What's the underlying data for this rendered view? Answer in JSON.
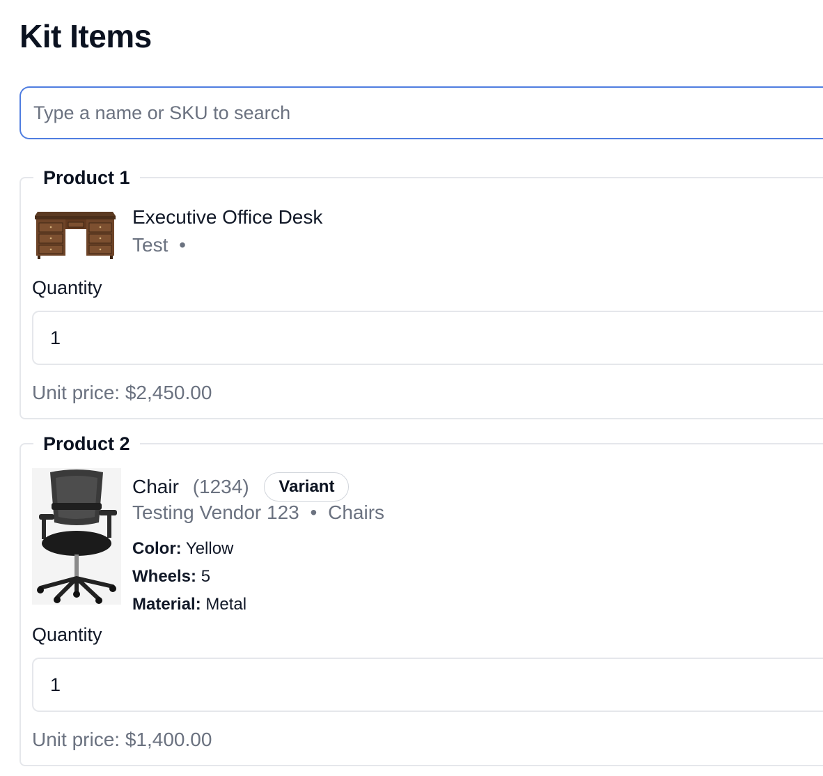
{
  "page": {
    "title": "Kit Items"
  },
  "search": {
    "placeholder": "Type a name or SKU to search",
    "value": ""
  },
  "products": [
    {
      "legend": "Product 1",
      "image_icon": "desk-image",
      "name": "Executive Office Desk",
      "vendor": "Test",
      "separator": "•",
      "category": "",
      "quantity_label": "Quantity",
      "quantity": "1",
      "price_label": "Unit price:",
      "price": "$2,450.00"
    },
    {
      "legend": "Product 2",
      "image_icon": "office-chair-image",
      "name": "Chair",
      "sku": "(1234)",
      "badge": "Variant",
      "vendor": "Testing Vendor 123",
      "separator": "•",
      "category": "Chairs",
      "attributes": [
        {
          "key": "Color:",
          "value": "Yellow"
        },
        {
          "key": "Wheels:",
          "value": "5"
        },
        {
          "key": "Material:",
          "value": "Metal"
        }
      ],
      "quantity_label": "Quantity",
      "quantity": "1",
      "price_label": "Unit price:",
      "price": "$1,400.00"
    }
  ]
}
